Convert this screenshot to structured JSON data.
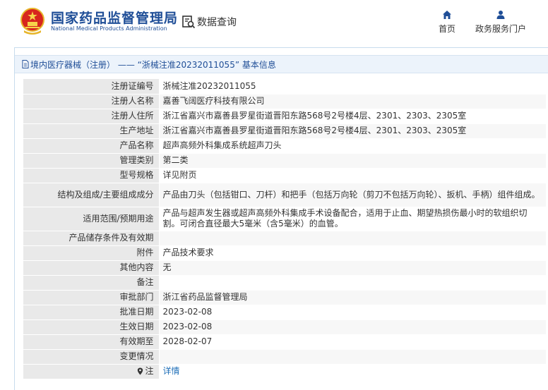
{
  "header": {
    "logo_cn": "国家药品监督管理局",
    "logo_en": "National Medical Products Administration",
    "query_label": "数据查询",
    "nav": {
      "home": "首页",
      "service": "政务服务门户"
    }
  },
  "crumb": "境内医疗器械（注册） —— “浙械注准20232011055” 基本信息",
  "rows": [
    {
      "label": "注册证编号",
      "value": "浙械注准20232011055"
    },
    {
      "label": "注册人名称",
      "value": "嘉善飞阔医疗科技有限公司"
    },
    {
      "label": "注册人住所",
      "value": "浙江省嘉兴市嘉善县罗星街道晋阳东路568号2号楼4层、2301、2303、2305室"
    },
    {
      "label": "生产地址",
      "value": "浙江省嘉兴市嘉善县罗星街道晋阳东路568号2号楼4层、2301、2303、2305室"
    },
    {
      "label": "产品名称",
      "value": "超声高频外科集成系统超声刀头"
    },
    {
      "label": "管理类别",
      "value": "第二类"
    },
    {
      "label": "型号规格",
      "value": "详见附页"
    },
    {
      "label": "结构及组成/主要组成成分",
      "value": "产品由刀头（包括钳口、刀杆）和把手（包括万向轮（剪刀不包括万向轮）、扳机、手柄）组件组成。"
    },
    {
      "label": "适用范围/预期用途",
      "value": "产品与超声发生器或超声高频外科集成手术设备配合，适用于止血、期望热损伤最小时的软组织切割。可闭合直径最大5毫米（含5毫米）的血管。"
    },
    {
      "label": "产品储存条件及有效期",
      "value": ""
    },
    {
      "label": "附件",
      "value": "产品技术要求"
    },
    {
      "label": "其他内容",
      "value": "无"
    },
    {
      "label": "备注",
      "value": ""
    },
    {
      "label": "审批部门",
      "value": "浙江省药品监督管理局"
    },
    {
      "label": "批准日期",
      "value": "2023-02-08"
    },
    {
      "label": "生效日期",
      "value": "2023-02-08"
    },
    {
      "label": "有效期至",
      "value": "2028-02-07"
    },
    {
      "label": "变更情况",
      "value": ""
    },
    {
      "label": "注",
      "value": "详情"
    }
  ],
  "colors": {
    "brand": "#1f4e97",
    "label_bg": "#e9e9e9",
    "link": "#1f6fb8",
    "head_bg": "#ecf3fb"
  },
  "icons": {
    "emblem": "national-emblem-icon",
    "query": "data-query-icon",
    "home": "home-icon",
    "service": "user-icon",
    "crumb": "document-icon",
    "note": "pin-icon"
  }
}
